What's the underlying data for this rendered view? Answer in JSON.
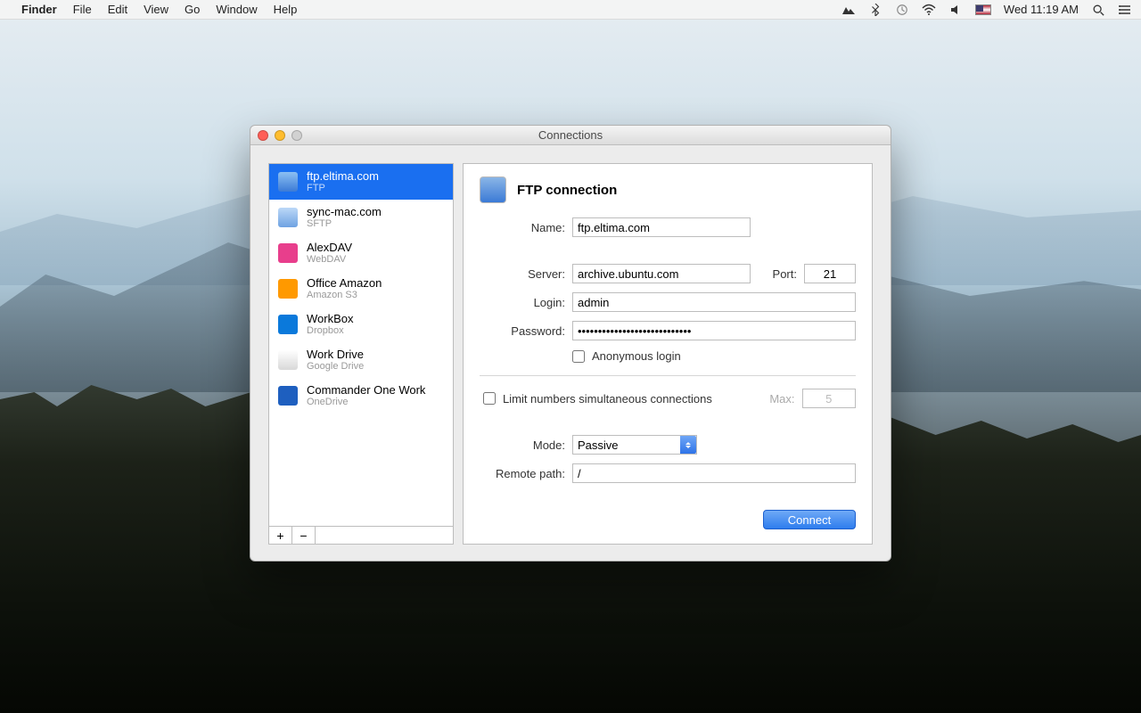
{
  "menubar": {
    "app_name": "Finder",
    "menus": [
      "File",
      "Edit",
      "View",
      "Go",
      "Window",
      "Help"
    ],
    "datetime": "Wed 11:19 AM"
  },
  "window": {
    "title": "Connections"
  },
  "sidebar": {
    "items": [
      {
        "name": "ftp.eltima.com",
        "subtitle": "FTP",
        "selected": true,
        "icon_bg": "linear-gradient(180deg,#8cc0f3,#3b7ad6)"
      },
      {
        "name": "sync-mac.com",
        "subtitle": "SFTP",
        "selected": false,
        "icon_bg": "linear-gradient(180deg,#bcd8f8,#6ea2e2)"
      },
      {
        "name": "AlexDAV",
        "subtitle": "WebDAV",
        "selected": false,
        "icon_bg": "#e83e8c"
      },
      {
        "name": "Office Amazon",
        "subtitle": "Amazon S3",
        "selected": false,
        "icon_bg": "#ff9900"
      },
      {
        "name": "WorkBox",
        "subtitle": "Dropbox",
        "selected": false,
        "icon_bg": "#0a79db"
      },
      {
        "name": "Work Drive",
        "subtitle": "Google Drive",
        "selected": false,
        "icon_bg": "linear-gradient(180deg,#ffffff,#d8d8d8)"
      },
      {
        "name": "Commander One Work",
        "subtitle": "OneDrive",
        "selected": false,
        "icon_bg": "#1e5fbf"
      }
    ],
    "add_label": "+",
    "remove_label": "−"
  },
  "detail": {
    "title": "FTP connection",
    "labels": {
      "name": "Name:",
      "server": "Server:",
      "port": "Port:",
      "login": "Login:",
      "password": "Password:",
      "anonymous": "Anonymous login",
      "limit": "Limit numbers simultaneous connections",
      "max": "Max:",
      "mode": "Mode:",
      "remote_path": "Remote path:"
    },
    "values": {
      "name": "ftp.eltima.com",
      "server": "archive.ubuntu.com",
      "port": "21",
      "login": "admin",
      "password": "••••••••••••••••••••••••••••",
      "anonymous": false,
      "limit": false,
      "max": "5",
      "mode": "Passive",
      "remote_path": "/"
    },
    "connect_label": "Connect"
  }
}
